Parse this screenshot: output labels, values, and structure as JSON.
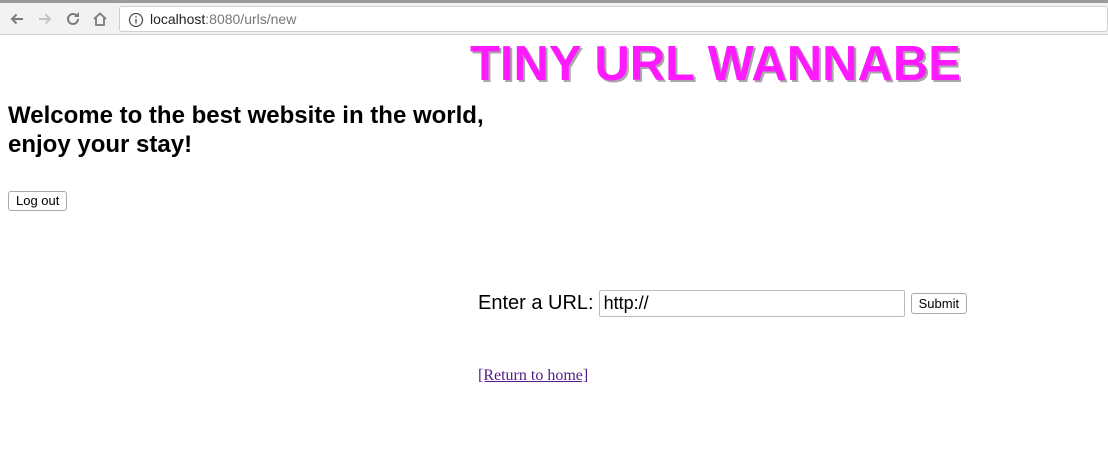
{
  "browser": {
    "url_host": "localhost",
    "url_rest": ":8080/urls/new"
  },
  "page": {
    "title": "TINY URL WANNABE",
    "welcome_line1": "Welcome to the best website in the world,",
    "welcome_line2": "enjoy your stay!",
    "logout_label": "Log out",
    "form": {
      "label": "Enter a URL:",
      "input_value": "http://",
      "submit_label": "Submit"
    },
    "return_link": "[Return to home]"
  },
  "colors": {
    "title": "#ff19ff",
    "title_shadow": "#a8a8a8",
    "visited_link": "#551a8b"
  }
}
